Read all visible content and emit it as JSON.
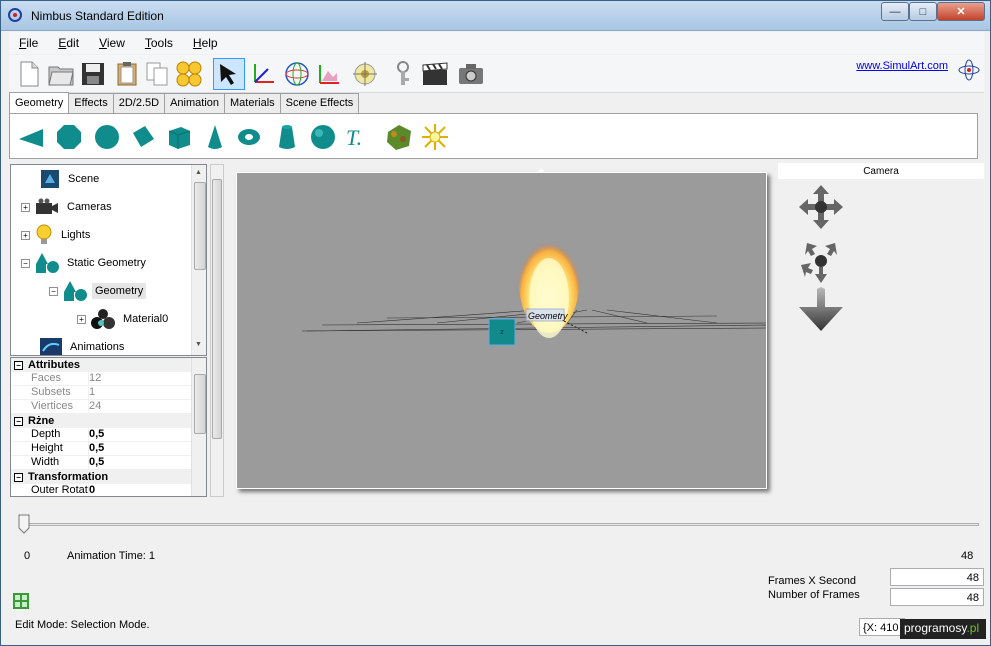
{
  "window": {
    "title": "Nimbus Standard Edition"
  },
  "menu": [
    "File",
    "Edit",
    "View",
    "Tools",
    "Help"
  ],
  "toolbar": {
    "icons": [
      "new-document-icon",
      "open-folder-icon",
      "save-disk-icon",
      "clipboard-icon",
      "copy-icon",
      "smileys-icon",
      "select-arrow-icon",
      "axes-icon",
      "globe-sphere-icon",
      "gallery-icon",
      "target-sphere-icon",
      "key-icon",
      "clapperboard-icon",
      "camera-icon"
    ],
    "link": "www.SimulArt.com"
  },
  "tabs": [
    {
      "label": "Geometry",
      "active": true
    },
    {
      "label": "Effects"
    },
    {
      "label": "2D/2.5D"
    },
    {
      "label": "Animation"
    },
    {
      "label": "Materials"
    },
    {
      "label": "Scene Effects"
    }
  ],
  "shapes": [
    "triangle-icon",
    "octagon-icon",
    "circle-icon",
    "diamond-icon",
    "cube-icon",
    "cone-icon",
    "torus-icon",
    "cylinder-icon",
    "sphere-icon",
    "text-icon",
    "terrain-icon",
    "light-burst-icon"
  ],
  "tree": [
    {
      "label": "Scene",
      "icon": "scene-icon"
    },
    {
      "label": "Cameras",
      "icon": "cameras-icon"
    },
    {
      "label": "Lights",
      "icon": "lightbulb-icon"
    },
    {
      "label": "Static Geometry",
      "icon": "static-geometry-icon"
    },
    {
      "label": "Geometry",
      "icon": "geometry-icon"
    },
    {
      "label": "Material0",
      "icon": "material-icon"
    },
    {
      "label": "Animations",
      "icon": "animations-icon"
    }
  ],
  "properties": {
    "attributes_title": "Attributes",
    "faces_label": "Faces",
    "faces_value": "12",
    "subsets_label": "Subsets",
    "subsets_value": "1",
    "vertices_label": "Viertices",
    "vertices_value": "24",
    "misc_title": "Rżne",
    "depth_label": "Depth",
    "depth_value": "0,5",
    "height_label": "Height",
    "height_value": "0,5",
    "width_label": "Width",
    "width_value": "0,5",
    "transform_title": "Transformation",
    "outer_label": "Outer Rotat",
    "outer_value": "0"
  },
  "viewport": {
    "object_label": "Geometry"
  },
  "camera": {
    "title": "Camera",
    "controls": [
      "move-cross-icon",
      "rotate-arrows-icon",
      "zoom-down-arrow-icon"
    ]
  },
  "timeline": {
    "start": "0",
    "end": "48",
    "time_label": "Animation Time: 1",
    "position_fraction": 0.0
  },
  "frames": {
    "fps_label": "Frames X Second",
    "fps_value": "48",
    "count_label": "Number of Frames",
    "count_value": "48"
  },
  "status": {
    "mode": "Edit Mode: Selection Mode.",
    "coords": "{X: 410"
  },
  "watermark": {
    "text_main": "programosy",
    "text_accent": ".pl"
  }
}
